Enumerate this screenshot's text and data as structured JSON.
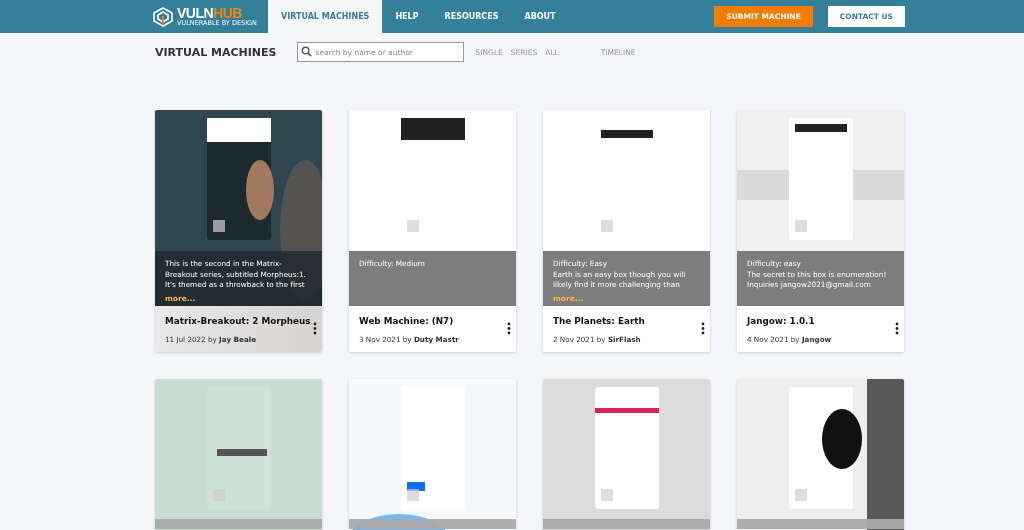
{
  "logo": {
    "part_a": "VULN",
    "part_b": "HUB",
    "tagline": "VULNERABLE BY DESIGN"
  },
  "nav": [
    {
      "label": "VIRTUAL MACHINES",
      "selected": true
    },
    {
      "label": "HELP",
      "selected": false
    },
    {
      "label": "RESOURCES",
      "selected": false
    },
    {
      "label": "ABOUT",
      "selected": false
    }
  ],
  "submit_button": "SUBMIT MACHINE",
  "contact_button": "CONTACT US",
  "page_title": "VIRTUAL MACHINES",
  "search": {
    "placeholder": "search by name or author"
  },
  "filters": [
    "SINGLE",
    "SERIES",
    "ALL"
  ],
  "timeline": "TIMELINE",
  "machines": [
    {
      "kind": "dark",
      "picture": {
        "kind": "picture"
      },
      "description": [
        "This is the second in the Matrix-Breakout series, subtitled Morpheus:1. It's themed as a throwback to the first"
      ],
      "more": "more...",
      "title": "Matrix-Breakout: 2 Morpheus",
      "date": "11 Jul 2022",
      "by": "by",
      "author": "Jay Beale"
    },
    {
      "kind": "light",
      "picture": {
        "kind": "picture"
      },
      "description": [
        "Difficulty: Medium"
      ],
      "title": "Web Machine: (N7)",
      "date": "3 Nov 2021",
      "by": "by",
      "author": "Duty Mastr"
    },
    {
      "kind": "light",
      "picture": {
        "kind": "picture"
      },
      "description": [
        "Difficulty: Easy",
        "Earth is an easy box though you will likely find it more challenging than"
      ],
      "more": "more...",
      "title": "The Planets: Earth",
      "date": "2 Nov 2021",
      "by": "by",
      "author": "SirFlash"
    },
    {
      "kind": "light",
      "picture": {
        "kind": "picture"
      },
      "description": [
        "Difficulty: easy",
        "The secret to this box is enumeration!",
        "Inquiries jangow2021@gmail.com"
      ],
      "title": "Jangow: 1.0.1",
      "date": "4 Nov 2021",
      "by": "by",
      "author": "Jangow"
    },
    {
      "kind": "partial",
      "picture": {
        "kind": "picture"
      }
    },
    {
      "kind": "partial",
      "picture": {
        "kind": "picture"
      }
    },
    {
      "kind": "partial",
      "picture": {
        "kind": "picture"
      }
    },
    {
      "kind": "partial",
      "picture": {
        "kind": "picture"
      }
    }
  ]
}
